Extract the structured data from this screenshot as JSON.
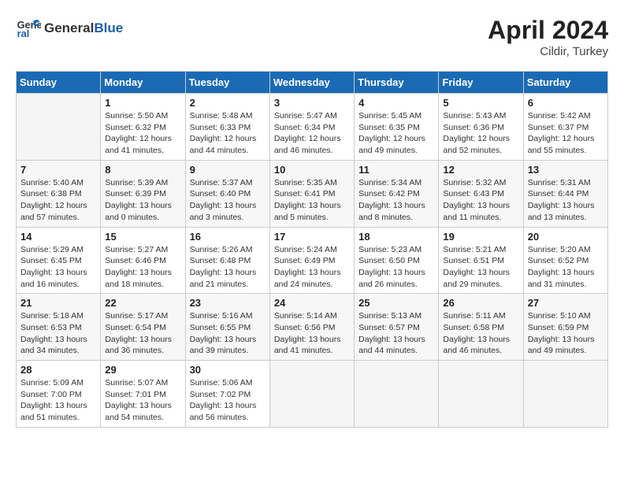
{
  "header": {
    "logo_line1": "General",
    "logo_line2": "Blue",
    "month_title": "April 2024",
    "subtitle": "Cildir, Turkey"
  },
  "days_of_week": [
    "Sunday",
    "Monday",
    "Tuesday",
    "Wednesday",
    "Thursday",
    "Friday",
    "Saturday"
  ],
  "weeks": [
    [
      {
        "day": "",
        "empty": true
      },
      {
        "day": "1",
        "sunrise": "Sunrise: 5:50 AM",
        "sunset": "Sunset: 6:32 PM",
        "daylight": "Daylight: 12 hours and 41 minutes."
      },
      {
        "day": "2",
        "sunrise": "Sunrise: 5:48 AM",
        "sunset": "Sunset: 6:33 PM",
        "daylight": "Daylight: 12 hours and 44 minutes."
      },
      {
        "day": "3",
        "sunrise": "Sunrise: 5:47 AM",
        "sunset": "Sunset: 6:34 PM",
        "daylight": "Daylight: 12 hours and 46 minutes."
      },
      {
        "day": "4",
        "sunrise": "Sunrise: 5:45 AM",
        "sunset": "Sunset: 6:35 PM",
        "daylight": "Daylight: 12 hours and 49 minutes."
      },
      {
        "day": "5",
        "sunrise": "Sunrise: 5:43 AM",
        "sunset": "Sunset: 6:36 PM",
        "daylight": "Daylight: 12 hours and 52 minutes."
      },
      {
        "day": "6",
        "sunrise": "Sunrise: 5:42 AM",
        "sunset": "Sunset: 6:37 PM",
        "daylight": "Daylight: 12 hours and 55 minutes."
      }
    ],
    [
      {
        "day": "7",
        "sunrise": "Sunrise: 5:40 AM",
        "sunset": "Sunset: 6:38 PM",
        "daylight": "Daylight: 12 hours and 57 minutes."
      },
      {
        "day": "8",
        "sunrise": "Sunrise: 5:39 AM",
        "sunset": "Sunset: 6:39 PM",
        "daylight": "Daylight: 13 hours and 0 minutes."
      },
      {
        "day": "9",
        "sunrise": "Sunrise: 5:37 AM",
        "sunset": "Sunset: 6:40 PM",
        "daylight": "Daylight: 13 hours and 3 minutes."
      },
      {
        "day": "10",
        "sunrise": "Sunrise: 5:35 AM",
        "sunset": "Sunset: 6:41 PM",
        "daylight": "Daylight: 13 hours and 5 minutes."
      },
      {
        "day": "11",
        "sunrise": "Sunrise: 5:34 AM",
        "sunset": "Sunset: 6:42 PM",
        "daylight": "Daylight: 13 hours and 8 minutes."
      },
      {
        "day": "12",
        "sunrise": "Sunrise: 5:32 AM",
        "sunset": "Sunset: 6:43 PM",
        "daylight": "Daylight: 13 hours and 11 minutes."
      },
      {
        "day": "13",
        "sunrise": "Sunrise: 5:31 AM",
        "sunset": "Sunset: 6:44 PM",
        "daylight": "Daylight: 13 hours and 13 minutes."
      }
    ],
    [
      {
        "day": "14",
        "sunrise": "Sunrise: 5:29 AM",
        "sunset": "Sunset: 6:45 PM",
        "daylight": "Daylight: 13 hours and 16 minutes."
      },
      {
        "day": "15",
        "sunrise": "Sunrise: 5:27 AM",
        "sunset": "Sunset: 6:46 PM",
        "daylight": "Daylight: 13 hours and 18 minutes."
      },
      {
        "day": "16",
        "sunrise": "Sunrise: 5:26 AM",
        "sunset": "Sunset: 6:48 PM",
        "daylight": "Daylight: 13 hours and 21 minutes."
      },
      {
        "day": "17",
        "sunrise": "Sunrise: 5:24 AM",
        "sunset": "Sunset: 6:49 PM",
        "daylight": "Daylight: 13 hours and 24 minutes."
      },
      {
        "day": "18",
        "sunrise": "Sunrise: 5:23 AM",
        "sunset": "Sunset: 6:50 PM",
        "daylight": "Daylight: 13 hours and 26 minutes."
      },
      {
        "day": "19",
        "sunrise": "Sunrise: 5:21 AM",
        "sunset": "Sunset: 6:51 PM",
        "daylight": "Daylight: 13 hours and 29 minutes."
      },
      {
        "day": "20",
        "sunrise": "Sunrise: 5:20 AM",
        "sunset": "Sunset: 6:52 PM",
        "daylight": "Daylight: 13 hours and 31 minutes."
      }
    ],
    [
      {
        "day": "21",
        "sunrise": "Sunrise: 5:18 AM",
        "sunset": "Sunset: 6:53 PM",
        "daylight": "Daylight: 13 hours and 34 minutes."
      },
      {
        "day": "22",
        "sunrise": "Sunrise: 5:17 AM",
        "sunset": "Sunset: 6:54 PM",
        "daylight": "Daylight: 13 hours and 36 minutes."
      },
      {
        "day": "23",
        "sunrise": "Sunrise: 5:16 AM",
        "sunset": "Sunset: 6:55 PM",
        "daylight": "Daylight: 13 hours and 39 minutes."
      },
      {
        "day": "24",
        "sunrise": "Sunrise: 5:14 AM",
        "sunset": "Sunset: 6:56 PM",
        "daylight": "Daylight: 13 hours and 41 minutes."
      },
      {
        "day": "25",
        "sunrise": "Sunrise: 5:13 AM",
        "sunset": "Sunset: 6:57 PM",
        "daylight": "Daylight: 13 hours and 44 minutes."
      },
      {
        "day": "26",
        "sunrise": "Sunrise: 5:11 AM",
        "sunset": "Sunset: 6:58 PM",
        "daylight": "Daylight: 13 hours and 46 minutes."
      },
      {
        "day": "27",
        "sunrise": "Sunrise: 5:10 AM",
        "sunset": "Sunset: 6:59 PM",
        "daylight": "Daylight: 13 hours and 49 minutes."
      }
    ],
    [
      {
        "day": "28",
        "sunrise": "Sunrise: 5:09 AM",
        "sunset": "Sunset: 7:00 PM",
        "daylight": "Daylight: 13 hours and 51 minutes."
      },
      {
        "day": "29",
        "sunrise": "Sunrise: 5:07 AM",
        "sunset": "Sunset: 7:01 PM",
        "daylight": "Daylight: 13 hours and 54 minutes."
      },
      {
        "day": "30",
        "sunrise": "Sunrise: 5:06 AM",
        "sunset": "Sunset: 7:02 PM",
        "daylight": "Daylight: 13 hours and 56 minutes."
      },
      {
        "day": "",
        "empty": true
      },
      {
        "day": "",
        "empty": true
      },
      {
        "day": "",
        "empty": true
      },
      {
        "day": "",
        "empty": true
      }
    ]
  ]
}
